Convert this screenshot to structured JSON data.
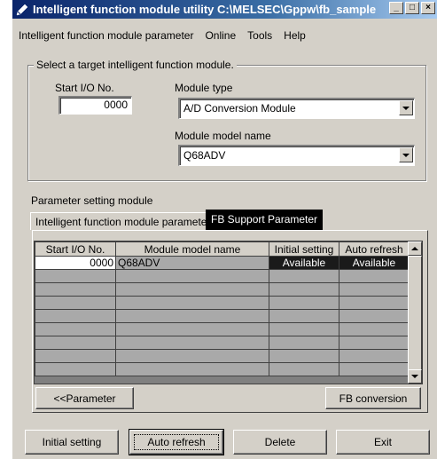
{
  "window": {
    "title": "Intelligent function module utility C:\\MELSEC\\Gppw\\fb_sample",
    "minimize_glyph": "_",
    "maximize_glyph": "□",
    "close_glyph": "×",
    "icon": "pencil-icon"
  },
  "menu": {
    "items": [
      {
        "label": "Intelligent function module parameter"
      },
      {
        "label": "Online"
      },
      {
        "label": "Tools"
      },
      {
        "label": "Help"
      }
    ]
  },
  "target": {
    "legend": "Select a target intelligent function module.",
    "start_io_label": "Start I/O No.",
    "start_io_value": "0000",
    "module_type_label": "Module type",
    "module_type_value": "A/D Conversion Module",
    "model_name_label": "Module model name",
    "model_name_value": "Q68ADV"
  },
  "param": {
    "section_label": "Parameter setting module",
    "tabs": [
      {
        "label": "Intelligent function module parameter",
        "active": false
      },
      {
        "label": "FB Support Parameter",
        "active": true
      }
    ],
    "columns": [
      "Start I/O No.",
      "Module model name",
      "Initial setting",
      "Auto refresh"
    ],
    "rows": [
      [
        "0000",
        "Q68ADV",
        "Available",
        "Available"
      ]
    ],
    "empty_rows": 8,
    "prev_button": "<<Parameter",
    "fb_conversion_button": "FB conversion"
  },
  "footer": {
    "initial_setting": "Initial setting",
    "auto_refresh": "Auto refresh",
    "delete": "Delete",
    "exit": "Exit"
  },
  "colors": {
    "face": "#d4d0c8",
    "title_start": "#0a246a",
    "title_end": "#a6caf0",
    "selected_cell": "#1a1a1a"
  }
}
